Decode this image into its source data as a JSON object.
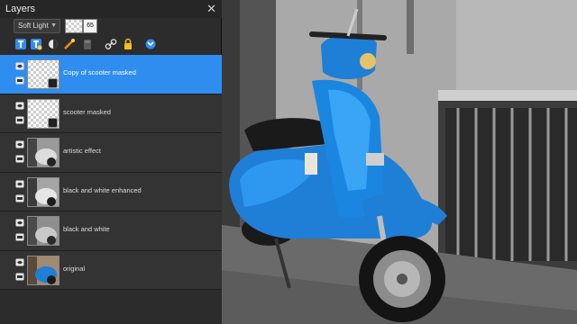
{
  "panel": {
    "title": "Layers",
    "blend_mode": "Soft Light",
    "opacity": "65"
  },
  "toolbar": {
    "tools": [
      {
        "icon": "new-layer-icon"
      },
      {
        "icon": "new-mask-icon"
      },
      {
        "icon": "adjustment-layer-icon"
      },
      {
        "icon": "effect-icon"
      },
      {
        "icon": "delete-layer-icon"
      },
      {
        "icon": "link-icon"
      },
      {
        "icon": "lock-icon"
      },
      {
        "icon": "merge-icon"
      }
    ]
  },
  "layers": [
    {
      "name": "Copy of scooter masked",
      "selected": true,
      "thumb": "checker"
    },
    {
      "name": "scooter masked",
      "selected": false,
      "thumb": "checker"
    },
    {
      "name": "artistic effect",
      "selected": false,
      "thumb": "bw"
    },
    {
      "name": "black and white enhanced",
      "selected": false,
      "thumb": "bw"
    },
    {
      "name": "black and white",
      "selected": false,
      "thumb": "bw"
    },
    {
      "name": "original",
      "selected": false,
      "thumb": "color"
    }
  ],
  "colors": {
    "selection": "#2f8df0",
    "panel_bg": "#2c2c2c",
    "scooter_blue": "#1f7fd6"
  }
}
